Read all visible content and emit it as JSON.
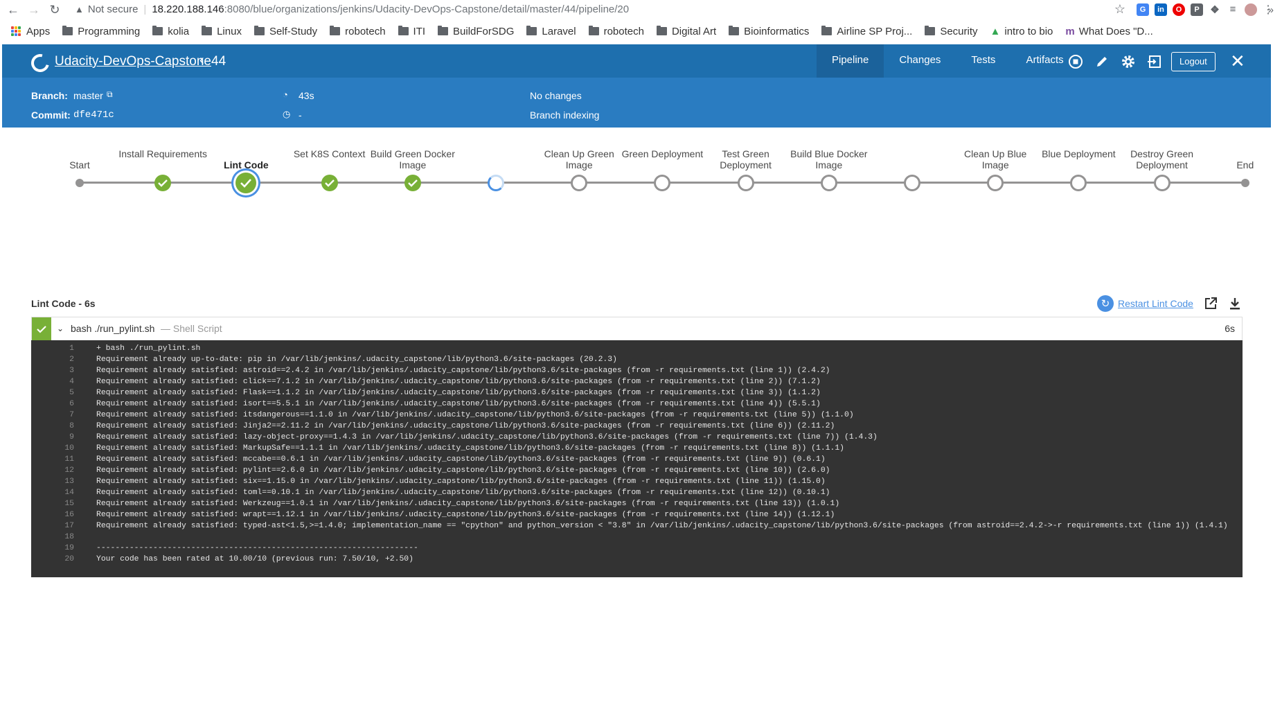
{
  "browser": {
    "security_label": "Not secure",
    "url_host": "18.220.188.146",
    "url_path": ":8080/blue/organizations/jenkins/Udacity-DevOps-Capstone/detail/master/44/pipeline/20",
    "bookmarks": [
      "Apps",
      "Programming",
      "kolia",
      "Linux",
      "Self-Study",
      "robotech",
      "ITI",
      "BuildForSDG",
      "Laravel",
      "robotech",
      "Digital Art",
      "Bioinformatics",
      "Airline SP Proj...",
      "Security",
      "intro to bio",
      "What Does \"D..."
    ],
    "more": "»"
  },
  "header": {
    "title": "Udacity-DevOps-Capstone",
    "run": "44",
    "tabs": [
      "Pipeline",
      "Changes",
      "Tests",
      "Artifacts"
    ],
    "logout": "Logout"
  },
  "summary": {
    "branch_label": "Branch:",
    "branch_value": "master",
    "commit_label": "Commit:",
    "commit_value": "dfe471c",
    "duration": "43s",
    "time": "-",
    "changes": "No changes",
    "cause": "Branch indexing"
  },
  "stages": [
    {
      "label": "Start",
      "state": "start"
    },
    {
      "label": "Install Requirements",
      "state": "success"
    },
    {
      "label": "Lint Code",
      "state": "selected"
    },
    {
      "label": "Set K8S Context",
      "state": "success"
    },
    {
      "label": "Build Green Docker Image",
      "state": "success"
    },
    {
      "label": "",
      "state": "running"
    },
    {
      "label": "Clean Up Green Image",
      "state": "pending"
    },
    {
      "label": "Green Deployment",
      "state": "pending"
    },
    {
      "label": "Test Green Deployment",
      "state": "pending"
    },
    {
      "label": "Build Blue Docker Image",
      "state": "pending"
    },
    {
      "label": "",
      "state": "pending"
    },
    {
      "label": "Clean Up Blue Image",
      "state": "pending"
    },
    {
      "label": "Blue Deployment",
      "state": "pending"
    },
    {
      "label": "Destroy Green Deployment",
      "state": "pending"
    },
    {
      "label": "End",
      "state": "end"
    }
  ],
  "log": {
    "title": "Lint Code - 6s",
    "restart_label": "Restart Lint Code",
    "step_command": "bash ./run_pylint.sh",
    "step_type": "— Shell Script",
    "step_duration": "6s",
    "lines": [
      {
        "n": "1",
        "t": "+ bash ./run_pylint.sh"
      },
      {
        "n": "2",
        "t": "Requirement already up-to-date: pip in /var/lib/jenkins/.udacity_capstone/lib/python3.6/site-packages (20.2.3)"
      },
      {
        "n": "3",
        "t": "Requirement already satisfied: astroid==2.4.2 in /var/lib/jenkins/.udacity_capstone/lib/python3.6/site-packages (from -r requirements.txt (line 1)) (2.4.2)"
      },
      {
        "n": "4",
        "t": "Requirement already satisfied: click==7.1.2 in /var/lib/jenkins/.udacity_capstone/lib/python3.6/site-packages (from -r requirements.txt (line 2)) (7.1.2)"
      },
      {
        "n": "5",
        "t": "Requirement already satisfied: Flask==1.1.2 in /var/lib/jenkins/.udacity_capstone/lib/python3.6/site-packages (from -r requirements.txt (line 3)) (1.1.2)"
      },
      {
        "n": "6",
        "t": "Requirement already satisfied: isort==5.5.1 in /var/lib/jenkins/.udacity_capstone/lib/python3.6/site-packages (from -r requirements.txt (line 4)) (5.5.1)"
      },
      {
        "n": "7",
        "t": "Requirement already satisfied: itsdangerous==1.1.0 in /var/lib/jenkins/.udacity_capstone/lib/python3.6/site-packages (from -r requirements.txt (line 5)) (1.1.0)"
      },
      {
        "n": "8",
        "t": "Requirement already satisfied: Jinja2==2.11.2 in /var/lib/jenkins/.udacity_capstone/lib/python3.6/site-packages (from -r requirements.txt (line 6)) (2.11.2)"
      },
      {
        "n": "9",
        "t": "Requirement already satisfied: lazy-object-proxy==1.4.3 in /var/lib/jenkins/.udacity_capstone/lib/python3.6/site-packages (from -r requirements.txt (line 7)) (1.4.3)"
      },
      {
        "n": "10",
        "t": "Requirement already satisfied: MarkupSafe==1.1.1 in /var/lib/jenkins/.udacity_capstone/lib/python3.6/site-packages (from -r requirements.txt (line 8)) (1.1.1)"
      },
      {
        "n": "11",
        "t": "Requirement already satisfied: mccabe==0.6.1 in /var/lib/jenkins/.udacity_capstone/lib/python3.6/site-packages (from -r requirements.txt (line 9)) (0.6.1)"
      },
      {
        "n": "12",
        "t": "Requirement already satisfied: pylint==2.6.0 in /var/lib/jenkins/.udacity_capstone/lib/python3.6/site-packages (from -r requirements.txt (line 10)) (2.6.0)"
      },
      {
        "n": "13",
        "t": "Requirement already satisfied: six==1.15.0 in /var/lib/jenkins/.udacity_capstone/lib/python3.6/site-packages (from -r requirements.txt (line 11)) (1.15.0)"
      },
      {
        "n": "14",
        "t": "Requirement already satisfied: toml==0.10.1 in /var/lib/jenkins/.udacity_capstone/lib/python3.6/site-packages (from -r requirements.txt (line 12)) (0.10.1)"
      },
      {
        "n": "15",
        "t": "Requirement already satisfied: Werkzeug==1.0.1 in /var/lib/jenkins/.udacity_capstone/lib/python3.6/site-packages (from -r requirements.txt (line 13)) (1.0.1)"
      },
      {
        "n": "16",
        "t": "Requirement already satisfied: wrapt==1.12.1 in /var/lib/jenkins/.udacity_capstone/lib/python3.6/site-packages (from -r requirements.txt (line 14)) (1.12.1)"
      },
      {
        "n": "17",
        "t": "Requirement already satisfied: typed-ast<1.5,>=1.4.0; implementation_name == \"cpython\" and python_version < \"3.8\" in /var/lib/jenkins/.udacity_capstone/lib/python3.6/site-packages (from astroid==2.4.2->-r requirements.txt (line 1)) (1.4.1)"
      },
      {
        "n": "18",
        "t": ""
      },
      {
        "n": "19",
        "t": "--------------------------------------------------------------------"
      },
      {
        "n": "20",
        "t": "Your code has been rated at 10.00/10 (previous run: 7.50/10, +2.50)"
      }
    ]
  },
  "colors": {
    "header_blue": "#1e6fae",
    "subheader_blue": "#2a7cc1",
    "success_green": "#78b037",
    "running_blue": "#4a90e2",
    "pending_gray": "#949393"
  }
}
